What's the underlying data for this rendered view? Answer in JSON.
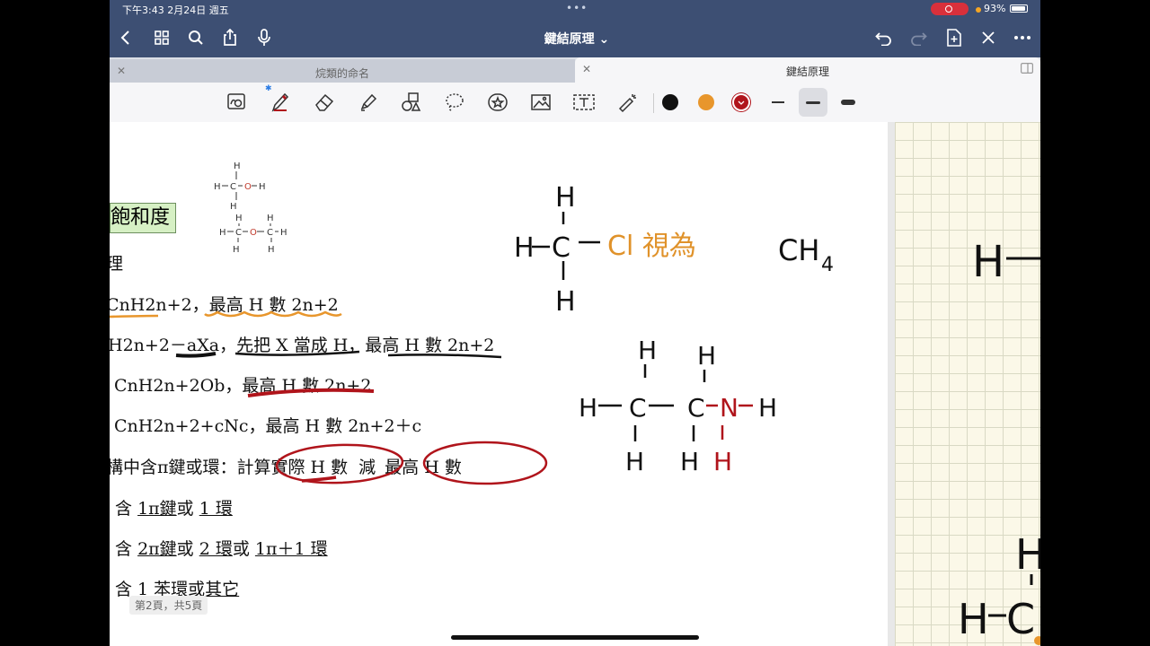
{
  "status": {
    "time": "下午3:43  2月24日 週五",
    "battery": "93%"
  },
  "nav": {
    "title": "鍵結原理 ⌄"
  },
  "tabs": [
    {
      "label": "烷類的命名",
      "active": false
    },
    {
      "label": "鍵結原理",
      "active": true
    }
  ],
  "toolbar": {
    "icons": [
      "lasso-zoom-icon",
      "pen-icon",
      "eraser-icon",
      "highlighter-icon",
      "shapes-icon",
      "lasso-icon",
      "sticker-icon",
      "image-icon",
      "text-icon",
      "laser-icon"
    ],
    "colors": {
      "black": "#111111",
      "orange": "#e8962c",
      "red": "#b0141b"
    }
  },
  "page": {
    "saturation": "飽和度",
    "lines": [
      "理",
      "CnH2n+2，",
      "最高 H 數 2n+2",
      "H2n+2－aXa，",
      "先把 X 當成 H，",
      "最高 H 數 2n+2",
      "CnH2n+2Ob，",
      "最高 H 數 2n+2",
      "CnH2n+2+cNc，最高 H 數 2n+2＋c",
      "構中含π鍵或環：計",
      "算實際 H 數",
      "減",
      "最高 H 數",
      "含",
      "1π鍵",
      "或",
      "1 環",
      "含",
      "2π鍵",
      "或",
      "2 環",
      "或",
      "1π＋1 環",
      "含 1 ",
      "苯環或其它"
    ],
    "page_indicator": "第2頁，共5頁"
  },
  "ink": {
    "methyl_chloride_label": "Cl 視為",
    "methane_formula_main": "CH",
    "methane_formula_sub": "4",
    "atoms": {
      "H": "H",
      "C": "C",
      "N": "N",
      "O": "O"
    }
  }
}
